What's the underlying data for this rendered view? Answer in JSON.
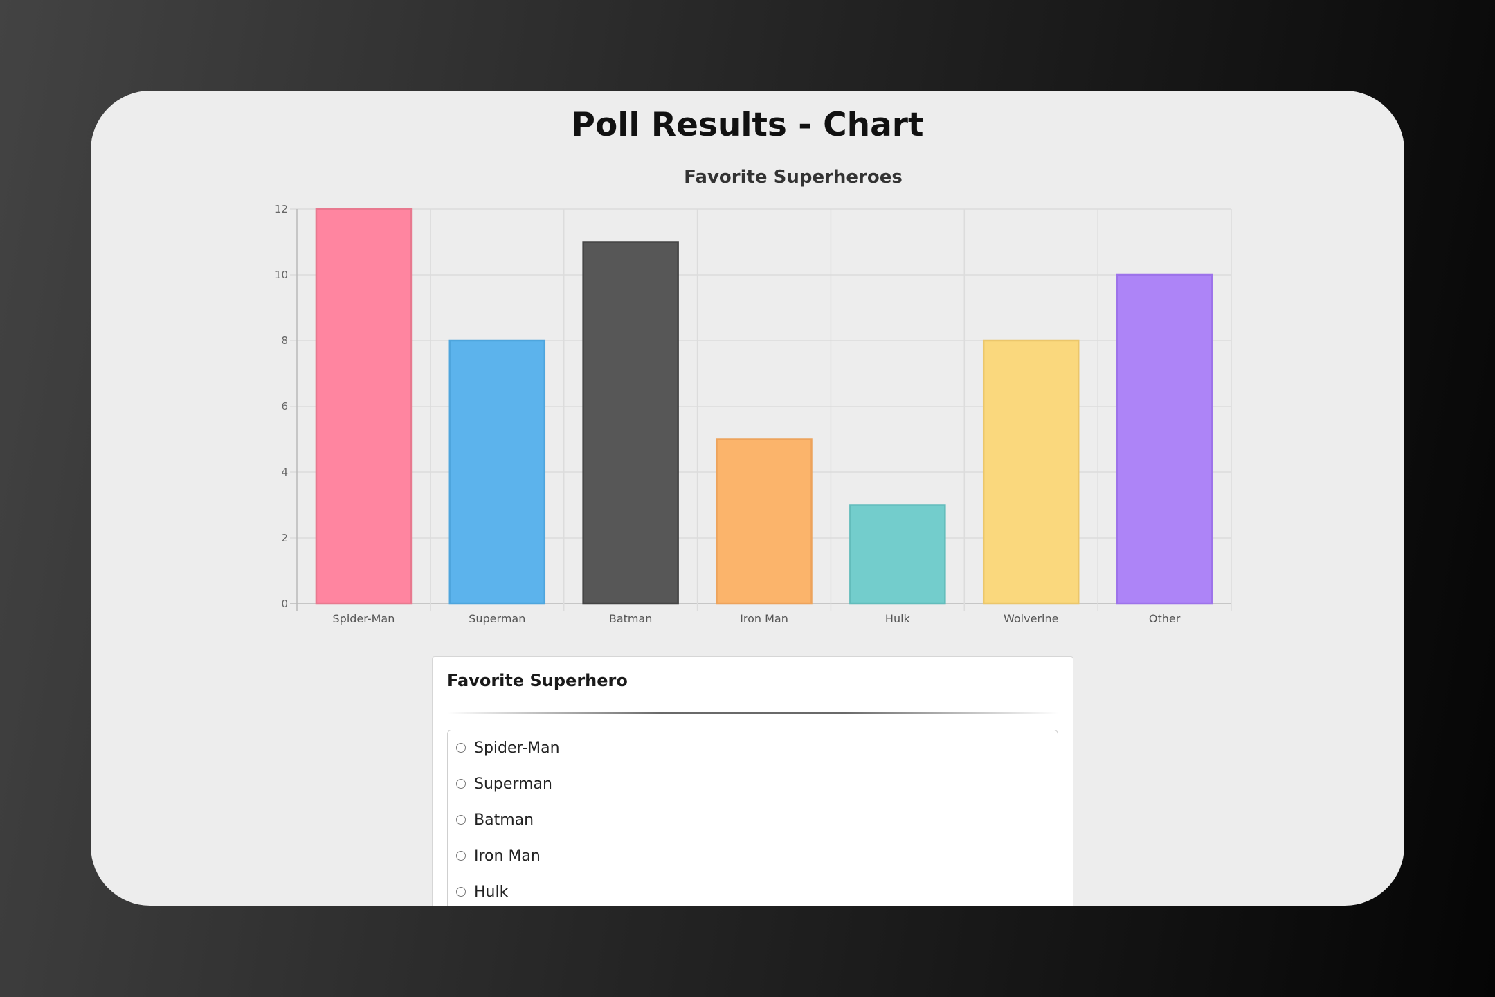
{
  "page": {
    "title": "Poll Results - Chart"
  },
  "chart_data": {
    "type": "bar",
    "title": "Favorite Superheroes",
    "categories": [
      "Spider-Man",
      "Superman",
      "Batman",
      "Iron Man",
      "Hulk",
      "Wolverine",
      "Other"
    ],
    "values": [
      12,
      8,
      11,
      5,
      3,
      8,
      10
    ],
    "colors": [
      "#ff85a0",
      "#5cb3ec",
      "#575757",
      "#fbb46b",
      "#73cdcc",
      "#fad87d",
      "#ad84f7"
    ],
    "border_colors": [
      "#e8798f",
      "#4ea5dd",
      "#444444",
      "#eda35c",
      "#62bcbb",
      "#ebc66b",
      "#9d73ea"
    ],
    "ylim": [
      0,
      12
    ],
    "yticks": [
      0,
      2,
      4,
      6,
      8,
      10,
      12
    ],
    "grid": true,
    "xlabel": "",
    "ylabel": ""
  },
  "poll": {
    "title": "Favorite Superhero",
    "options": [
      "Spider-Man",
      "Superman",
      "Batman",
      "Iron Man",
      "Hulk"
    ]
  }
}
